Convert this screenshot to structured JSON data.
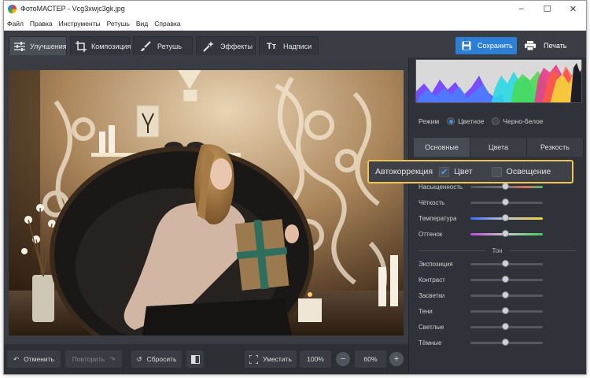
{
  "window": {
    "title": "ФотоМАСТЕР - Vcg3xwjc3gk.jpg",
    "controls": [
      "–",
      "☐",
      "✕"
    ]
  },
  "menu": [
    "Файл",
    "Правка",
    "Инструменты",
    "Ретушь",
    "Вид",
    "Справка"
  ],
  "tabs": [
    {
      "label": "Улучшения",
      "icon": "sliders-icon",
      "active": true
    },
    {
      "label": "Композиция",
      "icon": "crop-icon",
      "active": false
    },
    {
      "label": "Ретушь",
      "icon": "brush-icon",
      "active": false
    },
    {
      "label": "Эффекты",
      "icon": "effects-icon",
      "active": false
    },
    {
      "label": "Надписи",
      "icon": "text-icon",
      "active": false
    }
  ],
  "actions": {
    "save": "Сохранить",
    "print": "Печать"
  },
  "bottom": {
    "undo": "Отменить",
    "redo": "Повторить",
    "reset": "Сбросить",
    "fit": "Уместить",
    "zoom_actual": "100%",
    "zoom_value": "60%"
  },
  "panel": {
    "mode_label": "Режим",
    "mode_options": [
      "Цветное",
      "Черно-белое"
    ],
    "subtabs": [
      "Основные",
      "Цвета",
      "Резкость"
    ],
    "autocorrection": {
      "label": "Автокоррекция",
      "color": "Цвет",
      "lighting": "Освещение",
      "color_checked": true,
      "lighting_checked": false
    },
    "sliders_top": [
      "Насыщенность",
      "Чёткость",
      "Температура",
      "Оттенок"
    ],
    "section_title": "Тон",
    "sliders_tone": [
      "Экспозиция",
      "Контраст",
      "Засветки",
      "Тени",
      "Светлые",
      "Тёмные"
    ]
  },
  "colors": {
    "accent": "#2d7fd6",
    "highlight_border": "#f1c452"
  }
}
